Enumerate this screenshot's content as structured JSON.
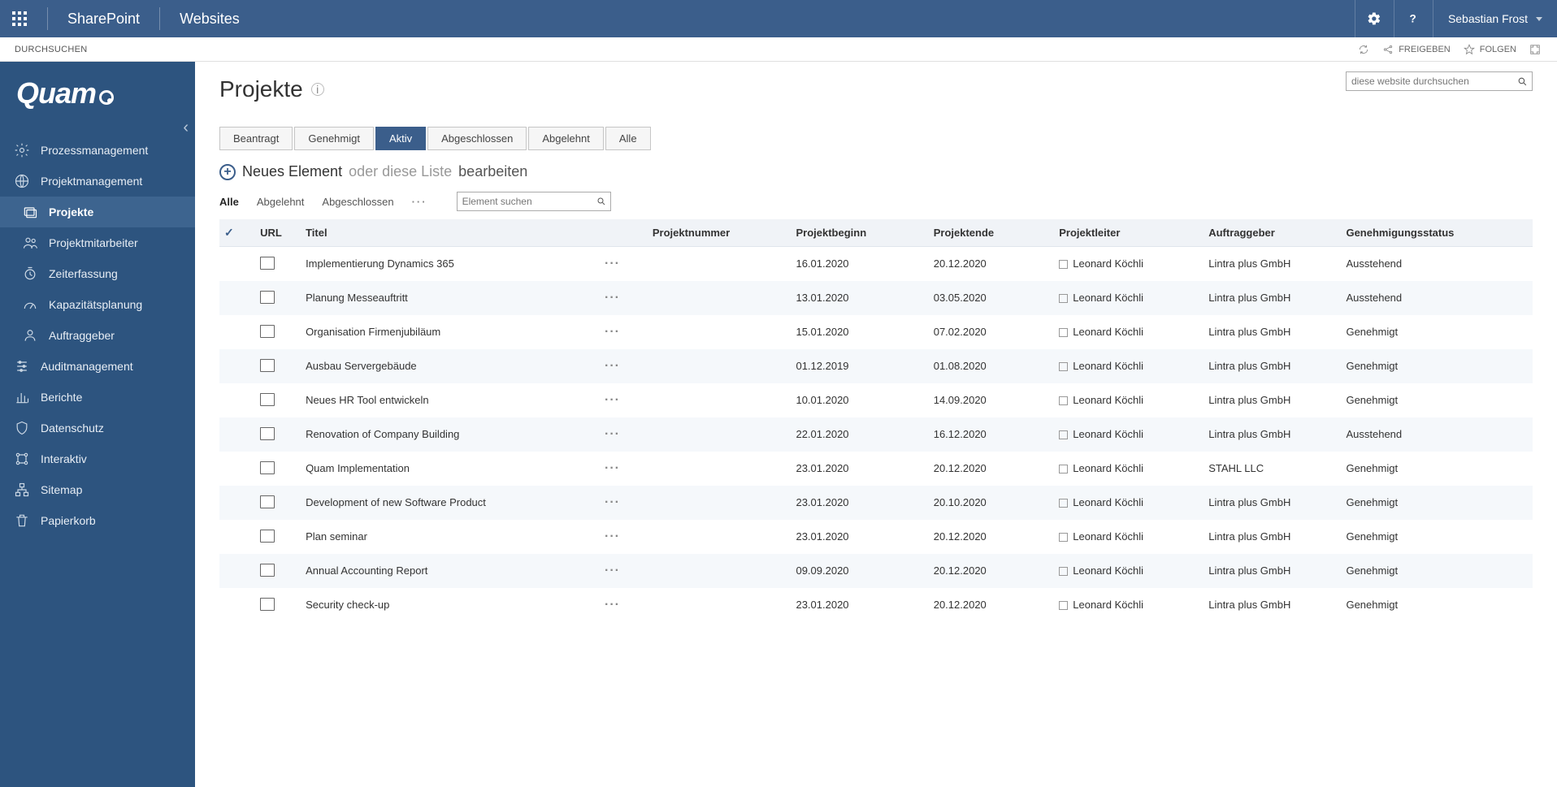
{
  "topbar": {
    "brand1": "SharePoint",
    "brand2": "Websites",
    "user": "Sebastian Frost"
  },
  "ribbon": {
    "tab1": "DURCHSUCHEN",
    "share": "FREIGEBEN",
    "follow": "FOLGEN"
  },
  "sidebar": {
    "logo": "Quam",
    "items": [
      {
        "label": "Prozessmanagement"
      },
      {
        "label": "Projektmanagement"
      },
      {
        "label": "Projekte"
      },
      {
        "label": "Projektmitarbeiter"
      },
      {
        "label": "Zeiterfassung"
      },
      {
        "label": "Kapazitätsplanung"
      },
      {
        "label": "Auftraggeber"
      },
      {
        "label": "Auditmanagement"
      },
      {
        "label": "Berichte"
      },
      {
        "label": "Datenschutz"
      },
      {
        "label": "Interaktiv"
      },
      {
        "label": "Sitemap"
      },
      {
        "label": "Papierkorb"
      }
    ]
  },
  "page": {
    "title": "Projekte",
    "search_placeholder": "diese website durchsuchen"
  },
  "filters": {
    "beantragt": "Beantragt",
    "genehmigt": "Genehmigt",
    "aktiv": "Aktiv",
    "abgeschlossen": "Abgeschlossen",
    "abgelehnt": "Abgelehnt",
    "alle": "Alle"
  },
  "newrow": {
    "new": "Neues Element",
    "or": "oder diese Liste",
    "edit": "bearbeiten"
  },
  "views": {
    "alle": "Alle",
    "abgelehnt": "Abgelehnt",
    "abgeschlossen": "Abgeschlossen",
    "search_placeholder": "Element suchen"
  },
  "columns": {
    "url": "URL",
    "titel": "Titel",
    "projektnummer": "Projektnummer",
    "projektbeginn": "Projektbeginn",
    "projektende": "Projektende",
    "projektleiter": "Projektleiter",
    "auftraggeber": "Auftraggeber",
    "genehmigungsstatus": "Genehmigungsstatus"
  },
  "rows": [
    {
      "titel": "Implementierung Dynamics 365",
      "beginn": "16.01.2020",
      "ende": "20.12.2020",
      "leiter": "Leonard Köchli",
      "auftrag": "Lintra plus GmbH",
      "status": "Ausstehend"
    },
    {
      "titel": "Planung Messeauftritt",
      "beginn": "13.01.2020",
      "ende": "03.05.2020",
      "leiter": "Leonard Köchli",
      "auftrag": "Lintra plus GmbH",
      "status": "Ausstehend"
    },
    {
      "titel": "Organisation Firmenjubiläum",
      "beginn": "15.01.2020",
      "ende": "07.02.2020",
      "leiter": "Leonard Köchli",
      "auftrag": "Lintra plus GmbH",
      "status": "Genehmigt"
    },
    {
      "titel": "Ausbau Servergebäude",
      "beginn": "01.12.2019",
      "ende": "01.08.2020",
      "leiter": "Leonard Köchli",
      "auftrag": "Lintra plus GmbH",
      "status": "Genehmigt"
    },
    {
      "titel": "Neues HR Tool entwickeln",
      "beginn": "10.01.2020",
      "ende": "14.09.2020",
      "leiter": "Leonard Köchli",
      "auftrag": "Lintra plus GmbH",
      "status": "Genehmigt"
    },
    {
      "titel": "Renovation of Company Building",
      "beginn": "22.01.2020",
      "ende": "16.12.2020",
      "leiter": "Leonard Köchli",
      "auftrag": "Lintra plus GmbH",
      "status": "Ausstehend"
    },
    {
      "titel": "Quam Implementation",
      "beginn": "23.01.2020",
      "ende": "20.12.2020",
      "leiter": "Leonard Köchli",
      "auftrag": "STAHL LLC",
      "status": "Genehmigt"
    },
    {
      "titel": "Development of new Software Product",
      "beginn": "23.01.2020",
      "ende": "20.10.2020",
      "leiter": "Leonard Köchli",
      "auftrag": "Lintra plus GmbH",
      "status": "Genehmigt"
    },
    {
      "titel": "Plan seminar",
      "beginn": "23.01.2020",
      "ende": "20.12.2020",
      "leiter": "Leonard Köchli",
      "auftrag": "Lintra plus GmbH",
      "status": "Genehmigt"
    },
    {
      "titel": "Annual Accounting Report",
      "beginn": "09.09.2020",
      "ende": "20.12.2020",
      "leiter": "Leonard Köchli",
      "auftrag": "Lintra plus GmbH",
      "status": "Genehmigt"
    },
    {
      "titel": "Security check-up",
      "beginn": "23.01.2020",
      "ende": "20.12.2020",
      "leiter": "Leonard Köchli",
      "auftrag": "Lintra plus GmbH",
      "status": "Genehmigt"
    }
  ]
}
